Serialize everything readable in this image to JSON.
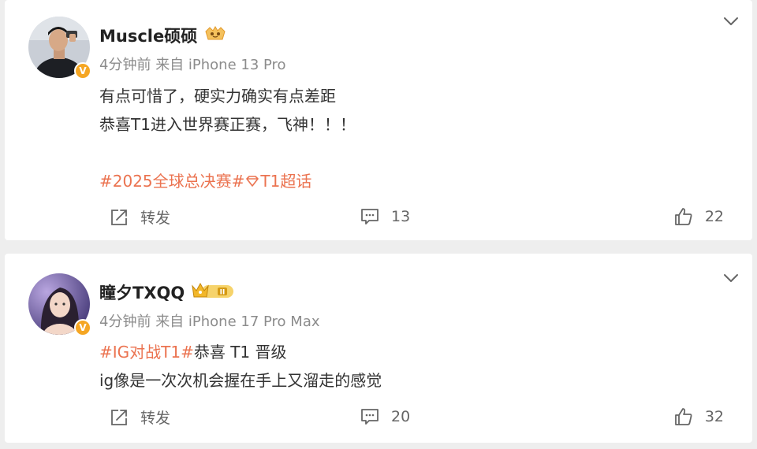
{
  "posts": [
    {
      "username": "Muscle硕硕",
      "time": "4分钟前",
      "source": "来自 iPhone 13 Pro",
      "lines": [
        "有点可惜了，硬实力确实有点差距",
        "恭喜T1进入世界赛正赛，飞神！！！"
      ],
      "topics_a": "#2025全球总决赛#",
      "topics_b": "T1超话",
      "repost_label": "转发",
      "comments": "13",
      "likes": "22"
    },
    {
      "username": "瞳夕TXQQ",
      "time": "4分钟前",
      "source": "来自 iPhone 17 Pro Max",
      "topic": "#IG对战T1#",
      "line1_rest": "恭喜 T1 晋级",
      "line2": "ig像是一次次机会握在手上又溜走的感觉",
      "repost_label": "转发",
      "comments": "20",
      "likes": "32"
    }
  ],
  "colors": {
    "topic": "#eb7350",
    "verified_badge": "#f5a623",
    "muted_text": "#8c8c8c",
    "background": "#eeeeee"
  },
  "icons": {
    "repost": "repost-icon",
    "comment": "comment-icon",
    "like": "thumbs-up-icon",
    "more": "chevron-down-icon",
    "verified": "verified-v-icon",
    "fan_badge": "fan-badge-icon",
    "crown_badge": "crown-level-badge-icon",
    "super_topic": "super-topic-diamond-icon"
  }
}
